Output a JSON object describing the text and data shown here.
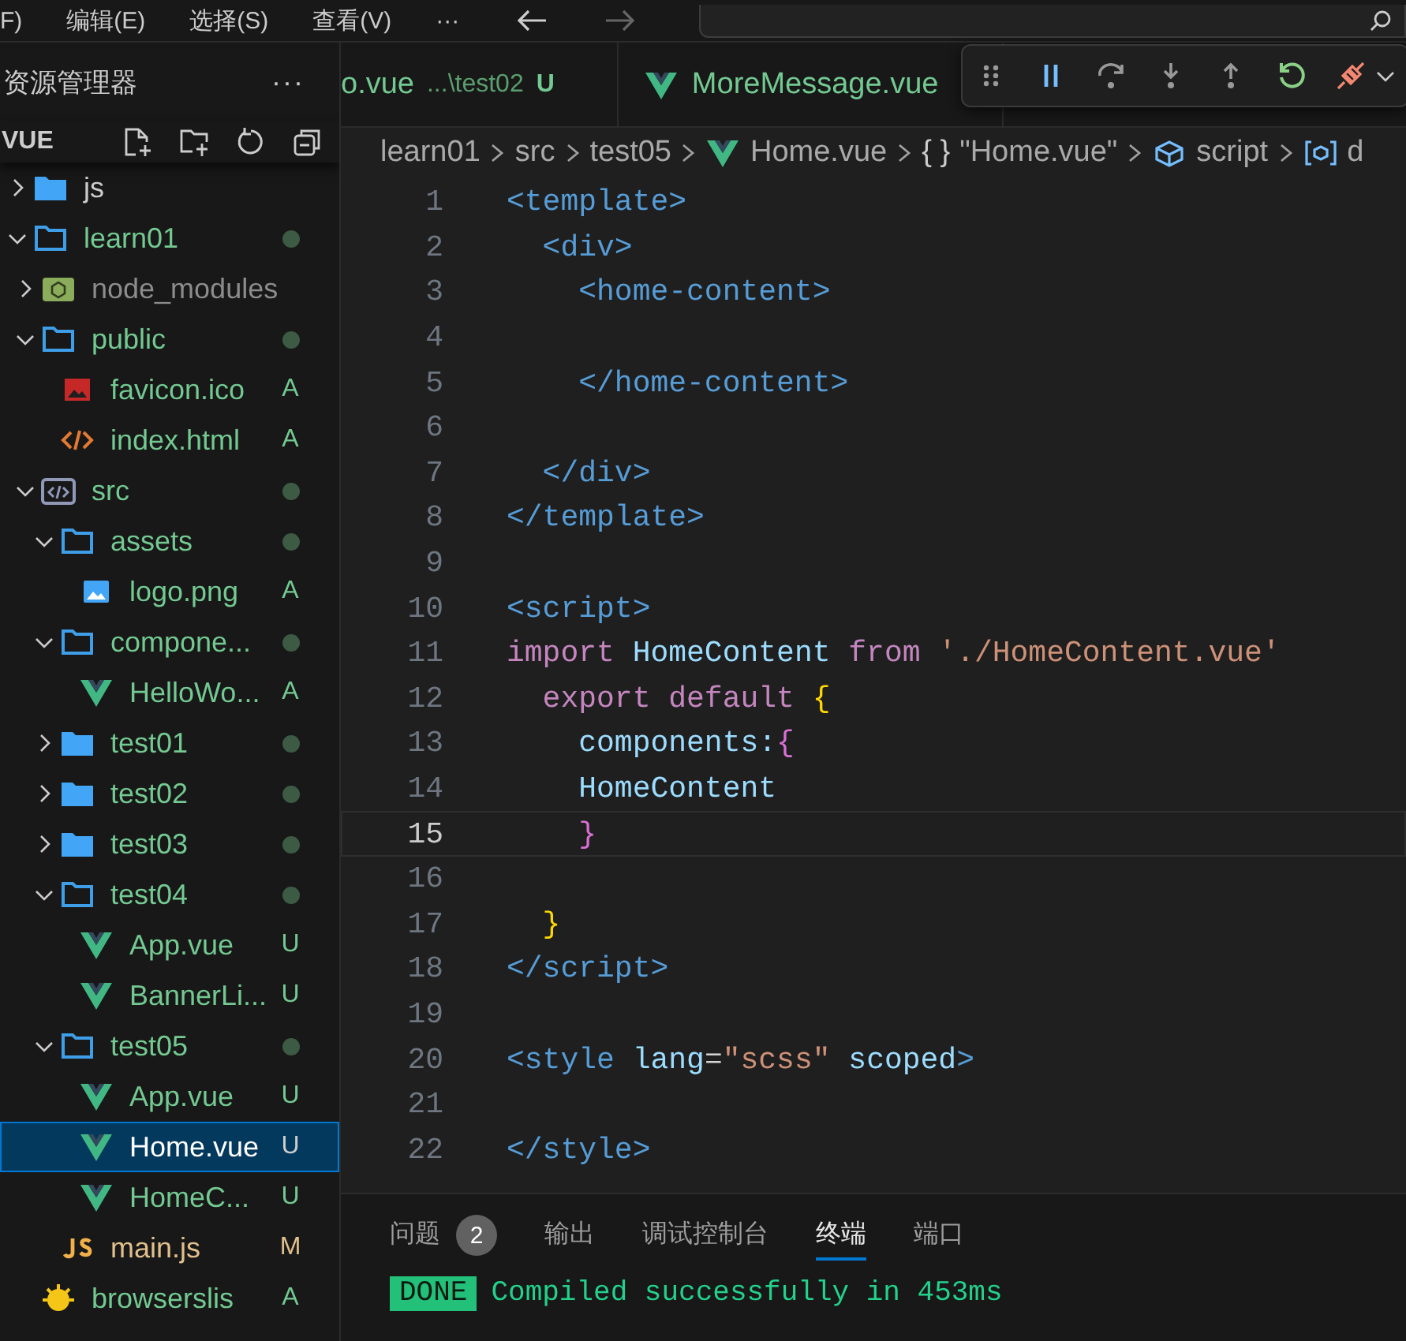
{
  "menu": [
    "F)",
    "编辑(E)",
    "选择(S)",
    "查看(V)",
    "···"
  ],
  "explorer": {
    "title": "资源管理器",
    "more": "···",
    "section": "VUE",
    "tree": [
      {
        "label": "js",
        "kind": "folder",
        "expanded": false,
        "color": "#cccccc",
        "changed": false,
        "selected": false
      },
      {
        "label": "learn01",
        "kind": "folder",
        "expanded": true,
        "color": "#73c991",
        "changed": true,
        "selected": false,
        "children": [
          {
            "label": "node_modules",
            "kind": "node",
            "expanded": false,
            "color": "#8c8c8c",
            "changed": false,
            "selected": false
          },
          {
            "label": "public",
            "kind": "folder",
            "expanded": true,
            "color": "#73c991",
            "changed": true,
            "selected": false,
            "children": [
              {
                "label": "favicon.ico",
                "kind": "favicon",
                "color": "#73c991",
                "badge": "A",
                "selected": false
              },
              {
                "label": "index.html",
                "kind": "html",
                "color": "#73c991",
                "badge": "A",
                "selected": false
              }
            ]
          },
          {
            "label": "src",
            "kind": "src",
            "expanded": true,
            "color": "#73c991",
            "changed": true,
            "selected": false,
            "children": [
              {
                "label": "assets",
                "kind": "folder",
                "expanded": true,
                "color": "#73c991",
                "changed": true,
                "selected": false,
                "children": [
                  {
                    "label": "logo.png",
                    "kind": "image",
                    "color": "#73c991",
                    "badge": "A",
                    "selected": false
                  }
                ]
              },
              {
                "label": "compone...",
                "kind": "folder",
                "expanded": true,
                "color": "#73c991",
                "changed": true,
                "selected": false,
                "children": [
                  {
                    "label": "HelloWo...",
                    "kind": "vue",
                    "color": "#73c991",
                    "badge": "A",
                    "selected": false
                  }
                ]
              },
              {
                "label": "test01",
                "kind": "folder",
                "expanded": false,
                "color": "#73c991",
                "changed": true,
                "selected": false
              },
              {
                "label": "test02",
                "kind": "folder",
                "expanded": false,
                "color": "#73c991",
                "changed": true,
                "selected": false
              },
              {
                "label": "test03",
                "kind": "folder",
                "expanded": false,
                "color": "#73c991",
                "changed": true,
                "selected": false
              },
              {
                "label": "test04",
                "kind": "folder",
                "expanded": true,
                "color": "#73c991",
                "changed": true,
                "selected": false,
                "children": [
                  {
                    "label": "App.vue",
                    "kind": "vue",
                    "color": "#73c991",
                    "badge": "U",
                    "selected": false
                  },
                  {
                    "label": "BannerLi...",
                    "kind": "vue",
                    "color": "#73c991",
                    "badge": "U",
                    "selected": false
                  }
                ]
              },
              {
                "label": "test05",
                "kind": "folder",
                "expanded": true,
                "color": "#73c991",
                "changed": true,
                "selected": false,
                "children": [
                  {
                    "label": "App.vue",
                    "kind": "vue",
                    "color": "#73c991",
                    "badge": "U",
                    "selected": false
                  },
                  {
                    "label": "Home.vue",
                    "kind": "vue",
                    "badge": "U",
                    "selected": true
                  },
                  {
                    "label": "HomeC...",
                    "kind": "vue",
                    "color": "#73c991",
                    "badge": "U",
                    "selected": false
                  }
                ]
              },
              {
                "label": "main.js",
                "kind": "js",
                "color": "#e2c08d",
                "badge": "M",
                "selected": false
              }
            ]
          },
          {
            "label": "browserslis",
            "kind": "config",
            "color": "#73c991",
            "badge": "A",
            "selected": false
          }
        ]
      }
    ]
  },
  "tabs": [
    {
      "label": "o.vue",
      "path": "...\\test02",
      "status": "U",
      "kind": "plain",
      "selected": false
    },
    {
      "label": "MoreMessage.vue",
      "kind": "vue",
      "selected": false
    }
  ],
  "breadcrumbs": [
    {
      "text": "learn01",
      "kind": "plain"
    },
    {
      "text": "src",
      "kind": "plain"
    },
    {
      "text": "test05",
      "kind": "plain"
    },
    {
      "text": "Home.vue",
      "kind": "vue"
    },
    {
      "text": "\"Home.vue\"",
      "kind": "plain",
      "symbol": "{ }"
    },
    {
      "text": "script",
      "kind": "cube"
    },
    {
      "text": "d",
      "kind": "field"
    }
  ],
  "code": [
    {
      "number": "1",
      "current": false,
      "tokens": [
        {
          "kind": "tag",
          "text": "<template>"
        }
      ]
    },
    {
      "number": "2",
      "current": false,
      "tokens": [
        {
          "kind": "tag",
          "text": "  <div>"
        }
      ]
    },
    {
      "number": "3",
      "current": false,
      "tokens": [
        {
          "kind": "tag",
          "text": "    <home-content>"
        }
      ]
    },
    {
      "number": "4",
      "current": false
    },
    {
      "number": "5",
      "current": false,
      "tokens": [
        {
          "kind": "tag",
          "text": "    </home-content>"
        }
      ]
    },
    {
      "number": "6",
      "current": false
    },
    {
      "number": "7",
      "current": false,
      "tokens": [
        {
          "kind": "tag",
          "text": "  </div>"
        }
      ]
    },
    {
      "number": "8",
      "current": false,
      "tokens": [
        {
          "kind": "tag",
          "text": "</template>"
        }
      ]
    },
    {
      "number": "9",
      "current": false
    },
    {
      "number": "10",
      "current": false,
      "tokens": [
        {
          "kind": "tag",
          "text": "<script>"
        }
      ]
    },
    {
      "number": "11",
      "current": false,
      "tokens": [
        {
          "kind": "keyword",
          "text": "import "
        },
        {
          "kind": "ident",
          "text": "HomeContent "
        },
        {
          "kind": "keyword",
          "text": "from "
        },
        {
          "kind": "string",
          "text": "'./HomeContent.vue'"
        }
      ]
    },
    {
      "number": "12",
      "current": false,
      "tokens": [
        {
          "kind": "keyword",
          "text": "  export default "
        },
        {
          "kind": "bracket1",
          "text": "{"
        }
      ]
    },
    {
      "number": "13",
      "current": false,
      "tokens": [
        {
          "kind": "ident",
          "text": "    components:"
        },
        {
          "kind": "bracket2",
          "text": "{"
        }
      ]
    },
    {
      "number": "14",
      "current": false,
      "tokens": [
        {
          "kind": "ident",
          "text": "    HomeContent"
        }
      ]
    },
    {
      "number": "15",
      "current": true,
      "tokens": [
        {
          "kind": "bracket2",
          "text": "    }"
        }
      ]
    },
    {
      "number": "16",
      "current": false
    },
    {
      "number": "17",
      "current": false,
      "tokens": [
        {
          "kind": "bracket1",
          "text": "  }"
        }
      ]
    },
    {
      "number": "18",
      "current": false,
      "tokens": [
        {
          "kind": "tag",
          "text": "</script>"
        }
      ]
    },
    {
      "number": "19",
      "current": false
    },
    {
      "number": "20",
      "current": false,
      "tokens": [
        {
          "kind": "tag",
          "text": "<style "
        },
        {
          "kind": "ident",
          "text": "lang"
        },
        {
          "kind": "plain",
          "text": "="
        },
        {
          "kind": "string",
          "text": "\"scss\" "
        },
        {
          "kind": "ident",
          "text": "scoped"
        },
        {
          "kind": "tag",
          "text": ">"
        }
      ]
    },
    {
      "number": "21",
      "current": false
    },
    {
      "number": "22",
      "current": false,
      "tokens": [
        {
          "kind": "tag",
          "text": "</style>"
        }
      ]
    }
  ],
  "panel": {
    "tabs": [
      {
        "label": "问题",
        "count": "2",
        "selected": false
      },
      {
        "label": "输出",
        "selected": false
      },
      {
        "label": "调试控制台",
        "selected": false
      },
      {
        "label": "终端",
        "selected": true
      },
      {
        "label": "端口",
        "selected": false
      }
    ],
    "terminal": {
      "badge": "DONE",
      "message": "Compiled successfully in 453ms"
    }
  }
}
